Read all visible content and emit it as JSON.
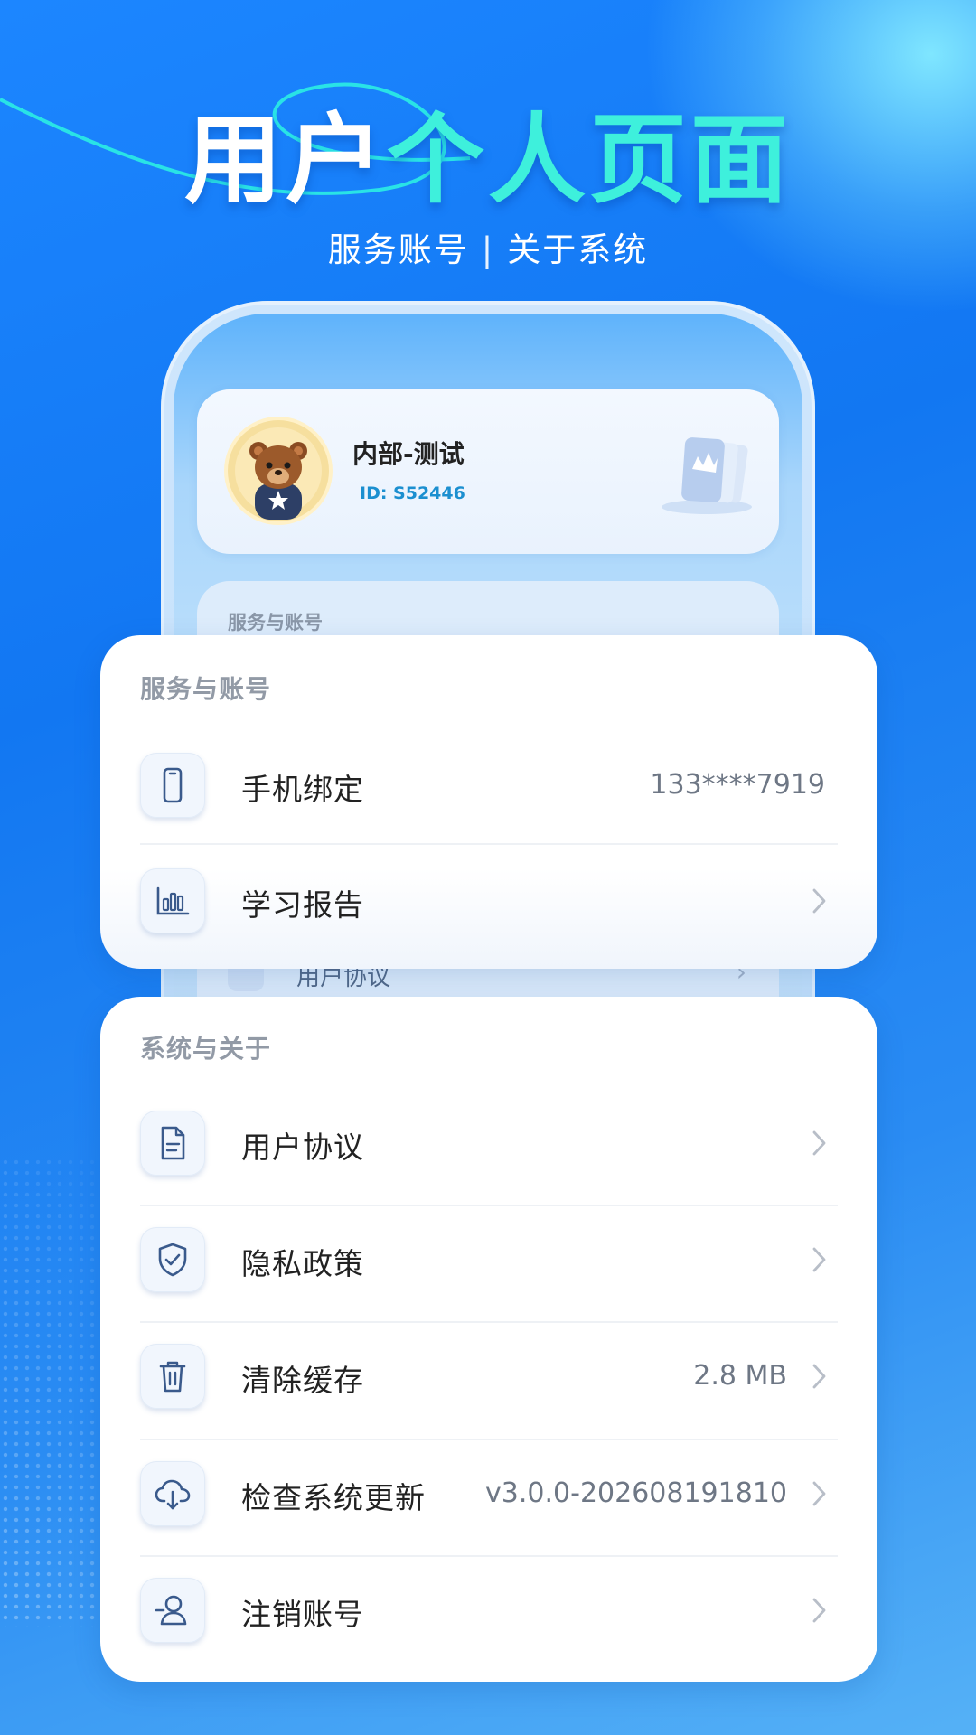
{
  "hero": {
    "title_white": "用户",
    "title_cyan": "个人页面",
    "subtitle_left": "服务账号",
    "subtitle_sep": "|",
    "subtitle_right": "关于系统"
  },
  "profile": {
    "name": "内部-测试",
    "id": "ID: S52446"
  },
  "behind": {
    "section_title": "服务与账号",
    "peek_row_label": "用户协议"
  },
  "service_section": {
    "title": "服务与账号",
    "items": [
      {
        "label": "手机绑定",
        "value": "133****7919",
        "icon": "phone-icon"
      },
      {
        "label": "学习报告",
        "value": "",
        "icon": "bar-chart-icon"
      }
    ]
  },
  "system_section": {
    "title": "系统与关于",
    "items": [
      {
        "label": "用户协议",
        "value": "",
        "icon": "document-icon"
      },
      {
        "label": "隐私政策",
        "value": "",
        "icon": "shield-check-icon"
      },
      {
        "label": "清除缓存",
        "value": "2.8 MB",
        "icon": "trash-icon"
      },
      {
        "label": "检查系统更新",
        "value": "v3.0.0-202608191810",
        "icon": "cloud-download-icon"
      },
      {
        "label": "注销账号",
        "value": "",
        "icon": "user-remove-icon"
      }
    ]
  },
  "colors": {
    "accent_cyan": "#3ef0dc",
    "background_blue": "#1277f2",
    "icon_stroke": "#3a5a8c"
  }
}
